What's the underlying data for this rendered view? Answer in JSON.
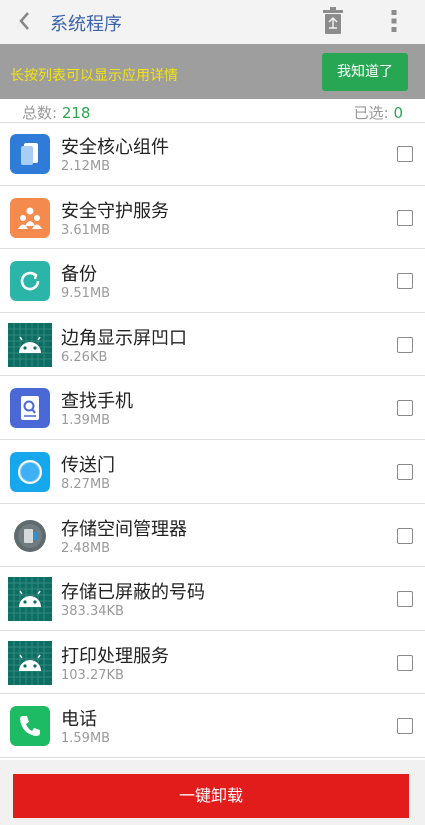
{
  "header": {
    "title": "系统程序"
  },
  "hint": {
    "text": "长按列表可以显示应用详情",
    "ok_label": "我知道了"
  },
  "counts": {
    "total_label": "总数:",
    "total": "218",
    "selected_label": "已选:",
    "selected": "0"
  },
  "apps": [
    {
      "name": "安全核心组件",
      "size": "2.12MB",
      "icon": "security-core-icon"
    },
    {
      "name": "安全守护服务",
      "size": "3.61MB",
      "icon": "family-guard-icon"
    },
    {
      "name": "备份",
      "size": "9.51MB",
      "icon": "backup-icon"
    },
    {
      "name": "边角显示屏凹口",
      "size": "6.26KB",
      "icon": "android-icon"
    },
    {
      "name": "查找手机",
      "size": "1.39MB",
      "icon": "find-phone-icon"
    },
    {
      "name": "传送门",
      "size": "8.27MB",
      "icon": "portal-icon"
    },
    {
      "name": "存储空间管理器",
      "size": "2.48MB",
      "icon": "storage-manager-icon"
    },
    {
      "name": "存储已屏蔽的号码",
      "size": "383.34KB",
      "icon": "android-icon"
    },
    {
      "name": "打印处理服务",
      "size": "103.27KB",
      "icon": "android-icon"
    },
    {
      "name": "电话",
      "size": "1.59MB",
      "icon": "phone-icon"
    }
  ],
  "footer": {
    "uninstall_label": "一键卸载"
  },
  "colors": {
    "accent": "#3a64b0",
    "hint_text": "#f4e40b",
    "ok_button": "#27a653",
    "uninstall": "#e21b1b",
    "count": "#2ea44f"
  }
}
